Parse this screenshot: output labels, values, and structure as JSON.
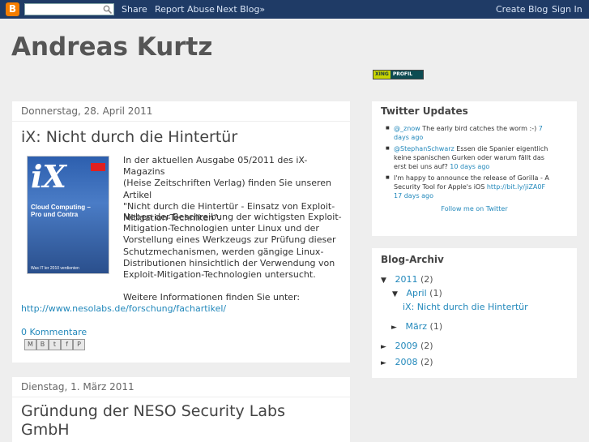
{
  "navbar": {
    "logo": "B",
    "search_placeholder": "",
    "share": "Share",
    "report_abuse": "Report Abuse",
    "next_blog": "Next Blog»",
    "create_blog": "Create Blog",
    "sign_in": "Sign In"
  },
  "header": {
    "title": "Andreas Kurtz",
    "xing_left": "XING",
    "xing_right": "PROFIL"
  },
  "post1": {
    "date": "Donnerstag, 28. April 2011",
    "title": "iX: Nicht durch die Hintertür",
    "image": {
      "logo": "iX",
      "cover_lines": "Cloud Computing –\nPro und Contra",
      "footer": "Was IT ler 2010 verdienten"
    },
    "p1": [
      "In der aktuellen Ausgabe 05/2011 des iX-Magazins",
      "(Heise Zeitschriften Verlag) finden Sie unseren Artikel",
      "\"Nicht durch die Hintertür - Einsatz von Exploit-",
      "Mitigation-Techniken\"."
    ],
    "p2": [
      "Neben der Beschreibung der wichtigsten Exploit-",
      "Mitigation-Technologien unter Linux und der",
      "Vorstellung eines Werkzeugs zur Prüfung dieser",
      "Schutzmechanismen, werden gängige Linux-",
      "Distributionen hinsichtlich der Verwendung von",
      "Exploit-Mitigation-Technologien untersucht."
    ],
    "p3": "Weitere Informationen finden Sie unter:",
    "link": "http://www.nesolabs.de/forschung/fachartikel/",
    "comments": "0 Kommentare",
    "share_buttons": [
      "M",
      "B",
      "t",
      "f",
      "P"
    ]
  },
  "post2": {
    "date": "Dienstag, 1. März 2011",
    "title_line1": "Gründung der NESO Security Labs",
    "title_line2": "GmbH"
  },
  "twitter": {
    "heading": "Twitter Updates",
    "items": [
      {
        "user": "@_znow",
        "text": "The early bird catches the worm :-)",
        "age": "7",
        "age2": "days ago"
      },
      {
        "user": "@StephanSchwarz",
        "text1": "Essen die Spanier eigentlich",
        "text2": "keine spanischen Gurken oder warum fällt das",
        "text3": "erst bei uns auf?",
        "age": "10 days ago"
      },
      {
        "text1": "I'm happy to announce the release of Gorilla - A",
        "text2": "Security Tool for Apple's iOS",
        "link": "http://bit.ly/jiZA0F",
        "age": "17 days ago"
      }
    ],
    "follow": "Follow me on Twitter"
  },
  "archive": {
    "heading": "Blog-Archiv",
    "rows": [
      {
        "arrow": "▼",
        "label": "2011",
        "count": "(2)"
      },
      {
        "arrow": "▼",
        "label": "April",
        "count": "(1)"
      },
      {
        "label": "iX: Nicht durch die Hintertür"
      },
      {
        "arrow": "►",
        "label": "März",
        "count": "(1)"
      },
      {
        "arrow": "►",
        "label": "2009",
        "count": "(2)"
      },
      {
        "arrow": "►",
        "label": "2008",
        "count": "(2)"
      }
    ]
  },
  "colors": {
    "navbar": "#1f3b66",
    "link": "#2288bb",
    "background": "#eeeeee"
  }
}
